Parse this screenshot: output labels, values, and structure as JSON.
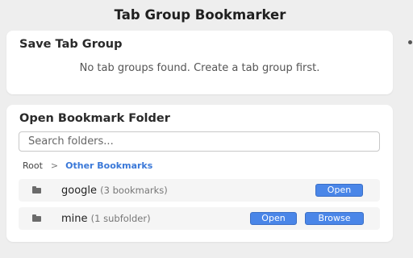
{
  "app": {
    "title": "Tab Group Bookmarker"
  },
  "save_section": {
    "title": "Save Tab Group",
    "empty_message": "No tab groups found. Create a tab group first."
  },
  "open_section": {
    "title": "Open Bookmark Folder",
    "search": {
      "placeholder": "Search folders...",
      "value": ""
    },
    "breadcrumb": {
      "root": "Root",
      "separator": ">",
      "current": "Other Bookmarks"
    },
    "folders": [
      {
        "name": "google",
        "meta": "(3 bookmarks)",
        "open_label": "Open"
      },
      {
        "name": "mine",
        "meta": "(1 subfolder)",
        "open_label": "Open",
        "browse_label": "Browse"
      }
    ]
  },
  "colors": {
    "accent": "#4a86e8",
    "link": "#3a78d8",
    "background": "#eeeeee",
    "card": "#ffffff",
    "row": "#f5f5f5"
  },
  "icons": {
    "folder": "folder-icon"
  }
}
